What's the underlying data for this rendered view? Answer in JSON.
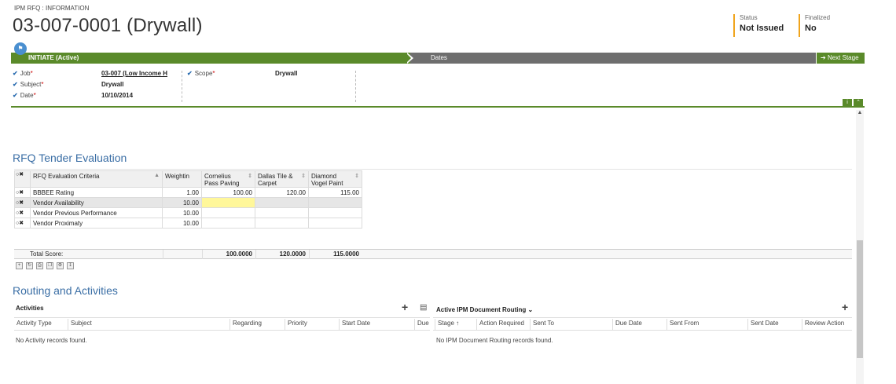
{
  "header": {
    "entity_label": "IPM RFQ : INFORMATION",
    "title": "03-007-0001 (Drywall)",
    "status_label": "Status",
    "status_value": "Not Issued",
    "finalized_label": "Finalized",
    "finalized_value": "No",
    "accent_color": "#f0a41c"
  },
  "process": {
    "active_stage": "INITIATE (Active)",
    "next_stage_name": "Dates",
    "next_stage_button": "Next Stage",
    "active_color": "#5a8a2a",
    "inactive_color": "#6e6e6e",
    "fields_left": [
      {
        "label": "Job",
        "value": "03-007 (Low Income H",
        "link": true
      },
      {
        "label": "Subject",
        "value": "Drywall",
        "link": false
      },
      {
        "label": "Date",
        "value": "10/10/2014",
        "link": false
      }
    ],
    "fields_right": [
      {
        "label": "Scope",
        "value": "Drywall"
      }
    ]
  },
  "tender": {
    "section_title": "RFQ Tender Evaluation",
    "columns": [
      "RFQ Evaluation Criteria",
      "Weighting",
      "Cornelius Pass Paving",
      "Dallas Tile & Carpet",
      "Diamond Vogel Paint"
    ],
    "column_lines": [
      [
        "RFQ Evaluation Criteria"
      ],
      [
        "Weightin"
      ],
      [
        "Cornelius",
        "Pass Paving"
      ],
      [
        "Dallas Tile &",
        "Carpet"
      ],
      [
        "Diamond",
        "Vogel Paint"
      ]
    ],
    "rows": [
      {
        "criteria": "BBBEE Rating",
        "weighting": "1.00",
        "v1": "100.00",
        "v2": "120.00",
        "v3": "115.00"
      },
      {
        "criteria": "Vendor Availability",
        "weighting": "10.00",
        "v1": "",
        "v2": "",
        "v3": ""
      },
      {
        "criteria": "Vendor Previous Performance",
        "weighting": "10.00",
        "v1": "",
        "v2": "",
        "v3": ""
      },
      {
        "criteria": "Vendor Proximaty",
        "weighting": "10.00",
        "v1": "",
        "v2": "",
        "v3": ""
      }
    ],
    "total_label": "Total Score:",
    "totals": [
      "100.0000",
      "120.0000",
      "115.0000"
    ]
  },
  "routing": {
    "section_title": "Routing and Activities",
    "activities_title": "Activities",
    "activities_columns": [
      "Activity Type",
      "Subject",
      "Regarding",
      "Priority",
      "Start Date",
      "Due Date"
    ],
    "activities_columns_display": [
      "Activity Type",
      "Subject",
      "Regarding",
      "Priority",
      "Start Date",
      "Due D"
    ],
    "activities_empty": "No Activity records found.",
    "doc_routing_title": "Active IPM Document Routing",
    "doc_columns": [
      "Stage",
      "Action Required",
      "Sent To",
      "Due Date",
      "Sent From",
      "Sent Date",
      "Review Action"
    ],
    "doc_empty": "No IPM Document Routing records found."
  }
}
